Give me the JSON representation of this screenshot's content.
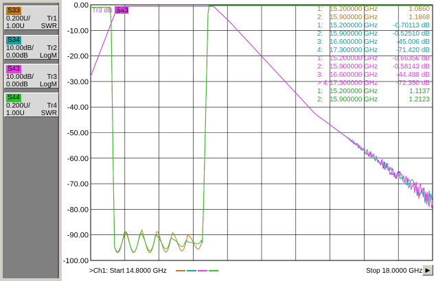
{
  "traces": [
    {
      "tag": "S33",
      "scale": "0.200U/",
      "ref": "1.00U",
      "tr": "Tr1",
      "fmt": "SWR",
      "color": "#c07a18"
    },
    {
      "tag": "S34",
      "scale": "10.00dB/",
      "ref": "0.00dB",
      "tr": "Tr2",
      "fmt": "LogM",
      "color": "#1aa0a0"
    },
    {
      "tag": "S43",
      "scale": "10.00dB/",
      "ref": "0.00dB",
      "tr": "Tr3",
      "fmt": "LogM",
      "color": "#e040e0"
    },
    {
      "tag": "S44",
      "scale": "0.200U/",
      "ref": "1.00U",
      "tr": "Tr4",
      "fmt": "SWR",
      "color": "#30c030"
    }
  ],
  "plot": {
    "active_label": "Tr3 dB",
    "active_tag": "S43",
    "y_ticks": [
      "0.00",
      "-10.00",
      "-20.00",
      "-30.00",
      "-40.00",
      "-50.00",
      "-60.00",
      "-70.00",
      "-80.00",
      "-90.00",
      "-100.00"
    ]
  },
  "markers": [
    {
      "num": "1:",
      "freq": "15.200000 GHz",
      "val": "1.0860",
      "color": "#b08020"
    },
    {
      "num": "2:",
      "freq": "15.900000 GHz",
      "val": "1.1868",
      "color": "#b08020"
    },
    {
      "num": "1:",
      "freq": "15.200000 GHz",
      "val": "-0.70113 dB",
      "color": "#1aa0a0"
    },
    {
      "num": "2:",
      "freq": "15.900000 GHz",
      "val": "-0.52510 dB",
      "color": "#1aa0a0"
    },
    {
      "num": "3:",
      "freq": "16.600000 GHz",
      "val": "-45.006 dB",
      "color": "#1aa0a0"
    },
    {
      "num": "4:",
      "freq": "17.300000 GHz",
      "val": "-71.420 dB",
      "color": "#1aa0a0"
    },
    {
      "num": "1:",
      "freq": "15.200000 GHz",
      "val": "-0.66356 dB",
      "color": "#e040e0"
    },
    {
      "num": "2:",
      "freq": "15.900000 GHz",
      "val": "-0.58143 dB",
      "color": "#e040e0"
    },
    {
      "num": "3:",
      "freq": "16.600000 GHz",
      "val": "-44.488 dB",
      "color": "#e040e0"
    },
    {
      "num": "> 4:",
      "freq": "17.300000 GHz",
      "val": "-72.350 dB",
      "color": "#e040e0"
    },
    {
      "num": "1:",
      "freq": "15.200000 GHz",
      "val": "1.1137",
      "color": "#30a030"
    },
    {
      "num": "2:",
      "freq": "15.900000 GHz",
      "val": "1.2123",
      "color": "#30a030"
    }
  ],
  "status": {
    "start": ">Ch1: Start  14.8000 GHz",
    "stop": "Stop  18.0000 GHz"
  },
  "icons": {
    "scroll": "scroll-right-icon"
  }
}
